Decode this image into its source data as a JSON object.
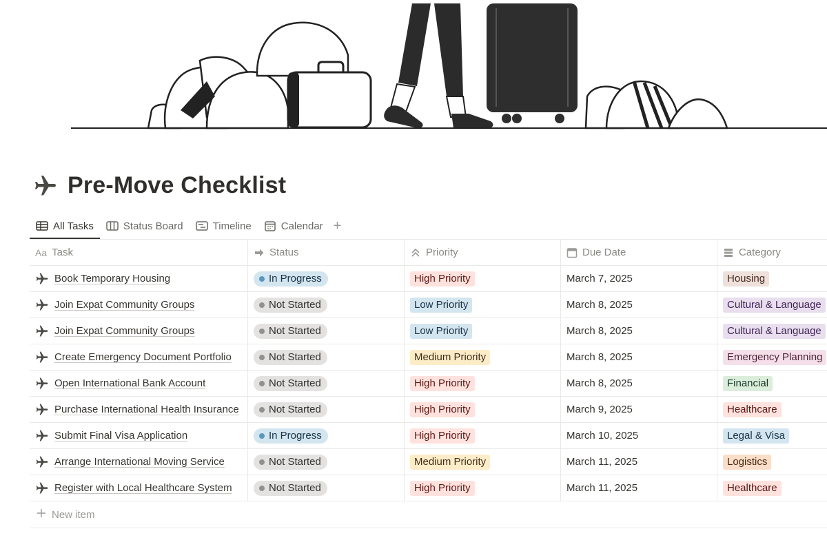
{
  "page": {
    "title": "Pre-Move Checklist",
    "title_icon": "airplane-icon",
    "cover": "travel-luggage-illustration"
  },
  "tabs": [
    {
      "label": "All Tasks",
      "icon": "table-icon",
      "active": true
    },
    {
      "label": "Status Board",
      "icon": "board-icon",
      "active": false
    },
    {
      "label": "Timeline",
      "icon": "timeline-icon",
      "active": false
    },
    {
      "label": "Calendar",
      "icon": "calendar-icon",
      "active": false
    }
  ],
  "tab_add_label": "+",
  "columns": [
    {
      "label": "Task",
      "icon_text": "Aa"
    },
    {
      "label": "Status",
      "icon": "status-arrow-icon"
    },
    {
      "label": "Priority",
      "icon": "chevrons-up-icon"
    },
    {
      "label": "Due Date",
      "icon": "calendar-icon"
    },
    {
      "label": "Category",
      "icon": "stack-icon"
    }
  ],
  "rows": [
    {
      "task": "Book Temporary Housing",
      "status": "In Progress",
      "priority": "High Priority",
      "due": "March 7, 2025",
      "category": "Housing"
    },
    {
      "task": "Join Expat Community Groups",
      "status": "Not Started",
      "priority": "Low Priority",
      "due": "March 8, 2025",
      "category": "Cultural & Language"
    },
    {
      "task": "Join Expat Community Groups",
      "status": "Not Started",
      "priority": "Low Priority",
      "due": "March 8, 2025",
      "category": "Cultural & Language"
    },
    {
      "task": "Create Emergency Document Portfolio",
      "status": "Not Started",
      "priority": "Medium Priority",
      "due": "March 8, 2025",
      "category": "Emergency Planning"
    },
    {
      "task": "Open International Bank Account",
      "status": "Not Started",
      "priority": "High Priority",
      "due": "March 8, 2025",
      "category": "Financial"
    },
    {
      "task": "Purchase International Health Insurance",
      "status": "Not Started",
      "priority": "High Priority",
      "due": "March 9, 2025",
      "category": "Healthcare"
    },
    {
      "task": "Submit Final Visa Application",
      "status": "In Progress",
      "priority": "High Priority",
      "due": "March 10, 2025",
      "category": "Legal & Visa"
    },
    {
      "task": "Arrange International Moving Service",
      "status": "Not Started",
      "priority": "Medium Priority",
      "due": "March 11, 2025",
      "category": "Logistics"
    },
    {
      "task": "Register with Local Healthcare System",
      "status": "Not Started",
      "priority": "High Priority",
      "due": "March 11, 2025",
      "category": "Healthcare"
    }
  ],
  "new_item_label": "New item",
  "colors": {
    "status": {
      "In Progress": {
        "bg": "#d3e5ef",
        "dot": "#5b97bd",
        "text": "#183347"
      },
      "Not Started": {
        "bg": "#e3e2e0",
        "dot": "#91918e",
        "text": "#32302c"
      }
    },
    "priority": {
      "High Priority": {
        "bg": "#ffe2dd",
        "text": "#5d1715"
      },
      "Medium Priority": {
        "bg": "#fdecc8",
        "text": "#402c1b"
      },
      "Low Priority": {
        "bg": "#d3e5ef",
        "text": "#183347"
      }
    },
    "category": {
      "Housing": {
        "bg": "#eee0da",
        "text": "#442a1e"
      },
      "Cultural & Language": {
        "bg": "#e8deee",
        "text": "#412454"
      },
      "Emergency Planning": {
        "bg": "#f5e0e9",
        "text": "#4c2337"
      },
      "Financial": {
        "bg": "#dbeddb",
        "text": "#1c3829"
      },
      "Healthcare": {
        "bg": "#ffe2dd",
        "text": "#5d1715"
      },
      "Legal & Visa": {
        "bg": "#d3e5ef",
        "text": "#183347"
      },
      "Logistics": {
        "bg": "#fadec9",
        "text": "#49290e"
      }
    }
  }
}
